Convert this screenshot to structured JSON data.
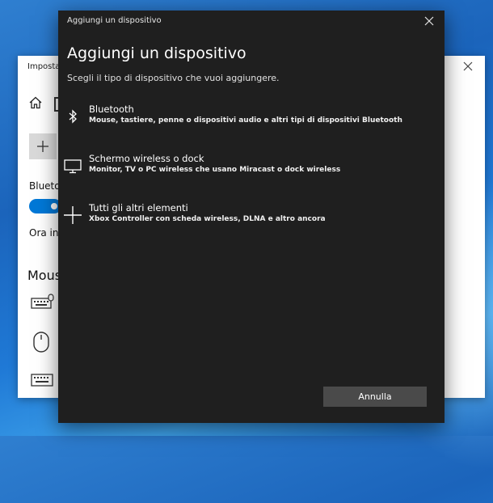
{
  "background_window": {
    "title": "Imposta",
    "bluetooth_label": "Blueto",
    "ora_label": "Ora in",
    "mouse_heading": "Mous"
  },
  "dialog": {
    "title": "Aggiungi un dispositivo",
    "heading": "Aggiungi un dispositivo",
    "subtitle": "Scegli il tipo di dispositivo che vuoi aggiungere.",
    "options": [
      {
        "icon": "bluetooth-icon",
        "title": "Bluetooth",
        "description": "Mouse, tastiere, penne o dispositivi audio e altri tipi di dispositivi Bluetooth"
      },
      {
        "icon": "monitor-icon",
        "title": "Schermo wireless o dock",
        "description": "Monitor, TV o PC wireless che usano Miracast o dock wireless"
      },
      {
        "icon": "plus-icon",
        "title": "Tutti gli altri elementi",
        "description": "Xbox Controller con scheda wireless, DLNA e altro ancora"
      }
    ],
    "cancel_label": "Annulla"
  },
  "colors": {
    "dialog_background": "#1f1f1f",
    "cancel_button": "#4a4a4a",
    "toggle_accent": "#0078d7"
  }
}
